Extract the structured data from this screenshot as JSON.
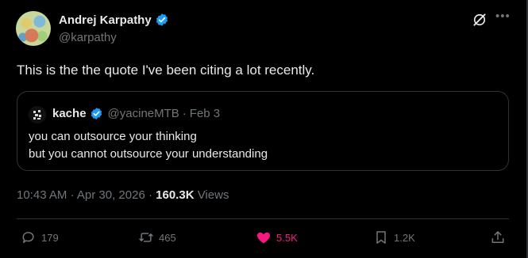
{
  "author": {
    "name": "Andrej Karpathy",
    "handle": "@karpathy"
  },
  "tweet": {
    "text": "This is the the quote I've been citing a lot recently."
  },
  "quote": {
    "name": "kache",
    "handle": "@yacineMTB",
    "separator": "·",
    "date": "Feb 3",
    "line1": "you can outsource your thinking",
    "line2": "but you cannot outsource your understanding"
  },
  "meta": {
    "time": "10:43 AM",
    "sep1": "·",
    "date": "Apr 30, 2026",
    "sep2": "·",
    "views_count": "160.3K",
    "views_label": "Views"
  },
  "actions": {
    "replies": "179",
    "reposts": "465",
    "likes": "5.5K",
    "bookmarks": "1.2K"
  },
  "icons": [
    "verified-badge-icon",
    "grok-icon",
    "more-icon",
    "reply-icon",
    "repost-icon",
    "heart-icon",
    "bookmark-icon",
    "share-icon"
  ],
  "colors": {
    "background": "#000000",
    "text": "#e7e9ea",
    "muted": "#71767b",
    "verified": "#1d9bf0",
    "like": "#f91880",
    "border": "#2f3336"
  }
}
